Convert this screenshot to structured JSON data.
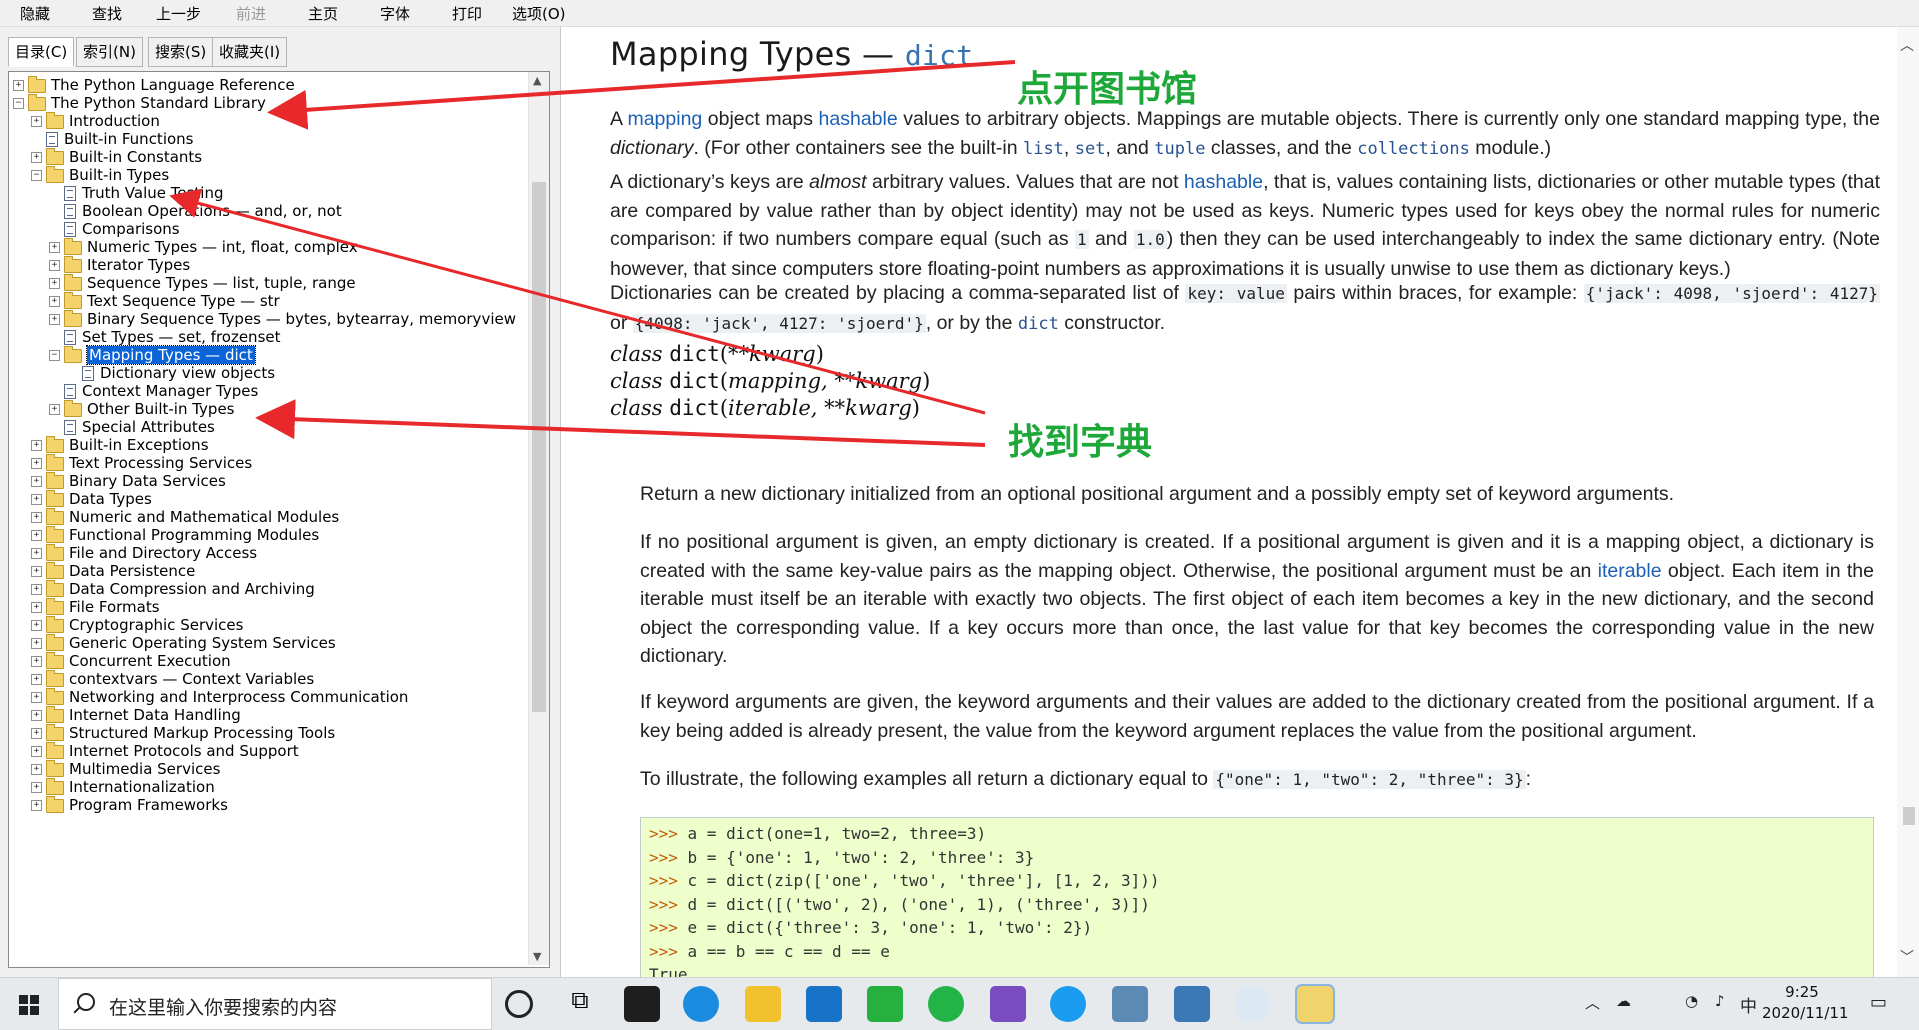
{
  "toolbar": {
    "hide": "隐藏",
    "find": "查找",
    "back": "上一步",
    "forward": "前进",
    "home": "主页",
    "font": "字体",
    "print": "打印",
    "options": "选项(O)"
  },
  "nav_tabs": [
    "目录(C)",
    "索引(N)",
    "搜索(S)",
    "收藏夹(I)"
  ],
  "tree": [
    "The Python Language Reference",
    "The Python Standard Library",
    "Introduction",
    "Built-in Functions",
    "Built-in Constants",
    "Built-in Types",
    "Truth Value Testing",
    "Boolean Operations — and, or, not",
    "Comparisons",
    "Numeric Types — int, float, complex",
    "Iterator Types",
    "Sequence Types — list, tuple, range",
    "Text Sequence Type — str",
    "Binary Sequence Types — bytes, bytearray, memoryview",
    "Set Types — set, frozenset",
    "Mapping Types — dict",
    "Dictionary view objects",
    "Context Manager Types",
    "Other Built-in Types",
    "Special Attributes",
    "Built-in Exceptions",
    "Text Processing Services",
    "Binary Data Services",
    "Data Types",
    "Numeric and Mathematical Modules",
    "Functional Programming Modules",
    "File and Directory Access",
    "Data Persistence",
    "Data Compression and Archiving",
    "File Formats",
    "Cryptographic Services",
    "Generic Operating System Services",
    "Concurrent Execution",
    "contextvars — Context Variables",
    "Networking and Interprocess Communication",
    "Internet Data Handling",
    "Structured Markup Processing Tools",
    "Internet Protocols and Support",
    "Multimedia Services",
    "Internationalization",
    "Program Frameworks"
  ],
  "doc": {
    "title": "Mapping Types — ",
    "title_code": "dict",
    "p1": {
      "a": "A ",
      "mapping": "mapping",
      "b": " object maps ",
      "hashable": "hashable",
      "c": " values to arbitrary objects. Mappings are mutable objects. There is currently only one standard mapping type, the ",
      "dictionary": "dictionary",
      "d": ". (For other containers see the built-in ",
      "list": "list",
      "e": ", ",
      "set": "set",
      "f": ", and ",
      "tuple": "tuple",
      "g": " classes, and the ",
      "collections": "collections",
      "h": " module.)"
    },
    "p2": {
      "a": "A dictionary’s keys are ",
      "almost": "almost",
      "b": " arbitrary values. Values that are not ",
      "hashable": "hashable",
      "c": ", that is, values containing lists, dictionaries or other mutable types (that are compared by value rather than by object identity) may not be used as keys. Numeric types used for keys obey the normal rules for numeric comparison: if two numbers compare equal (such as ",
      "one": "1",
      "d": " and ",
      "onef": "1.0",
      "e": ") then they can be used interchangeably to index the same dictionary entry. (Note however, that since computers store floating-point numbers as approximations it is usually unwise to use them as dictionary keys.)"
    },
    "p3": {
      "a": "Dictionaries can be created by placing a comma-separated list of ",
      "kv": "key: value",
      "b": " pairs within braces, for example: ",
      "ex1": "{'jack': 4098, 'sjoerd': 4127}",
      "c": " or ",
      "ex2": "{4098: 'jack', 4127: 'sjoerd'}",
      "d": ", or by the ",
      "dict": "dict",
      "e": " constructor."
    },
    "sig1": {
      "kw": "class ",
      "name": "dict",
      "args": "**kwarg"
    },
    "sig2": {
      "kw": "class ",
      "name": "dict",
      "args": "mapping, **kwarg"
    },
    "sig3": {
      "kw": "class ",
      "name": "dict",
      "args": "iterable, **kwarg"
    },
    "dd1": "Return a new dictionary initialized from an optional positional argument and a possibly empty set of keyword arguments.",
    "dd2": {
      "a": "If no positional argument is given, an empty dictionary is created. If a positional argument is given and it is a mapping object, a dictionary is created with the same key-value pairs as the mapping object. Otherwise, the positional argument must be an ",
      "iterable": "iterable",
      "b": " object. Each item in the iterable must itself be an iterable with exactly two objects. The first object of each item becomes a key in the new dictionary, and the second object the corresponding value. If a key occurs more than once, the last value for that key becomes the corresponding value in the new dictionary."
    },
    "dd3": "If keyword arguments are given, the keyword arguments and their values are added to the dictionary created from the positional argument. If a key being added is already present, the value from the keyword argument replaces the value from the positional argument.",
    "dd4": {
      "a": "To illustrate, the following examples all return a dictionary equal to ",
      "lit": "{\"one\": 1, \"two\": 2, \"three\": 3}",
      "b": ":"
    },
    "code_prompt": ">>> ",
    "code_lines": [
      "a = dict(one=1, two=2, three=3)",
      "b = {'one': 1, 'two': 2, 'three': 3}",
      "c = dict(zip(['one', 'two', 'three'], [1, 2, 3]))",
      "d = dict([('two', 2), ('one', 1), ('three', 3)])",
      "e = dict({'three': 3, 'one': 1, 'two': 2})",
      "a == b == c == d == e"
    ],
    "code_result": "True"
  },
  "annotations": {
    "library": "点开图书馆",
    "dict": "找到字典"
  },
  "annotation_color": "#1fa83a",
  "arrow_color": "#e8292b",
  "taskbar": {
    "search_placeholder": "在这里输入你要搜索的内容",
    "time": "9:25",
    "date": "2020/11/11",
    "ime": "中"
  }
}
